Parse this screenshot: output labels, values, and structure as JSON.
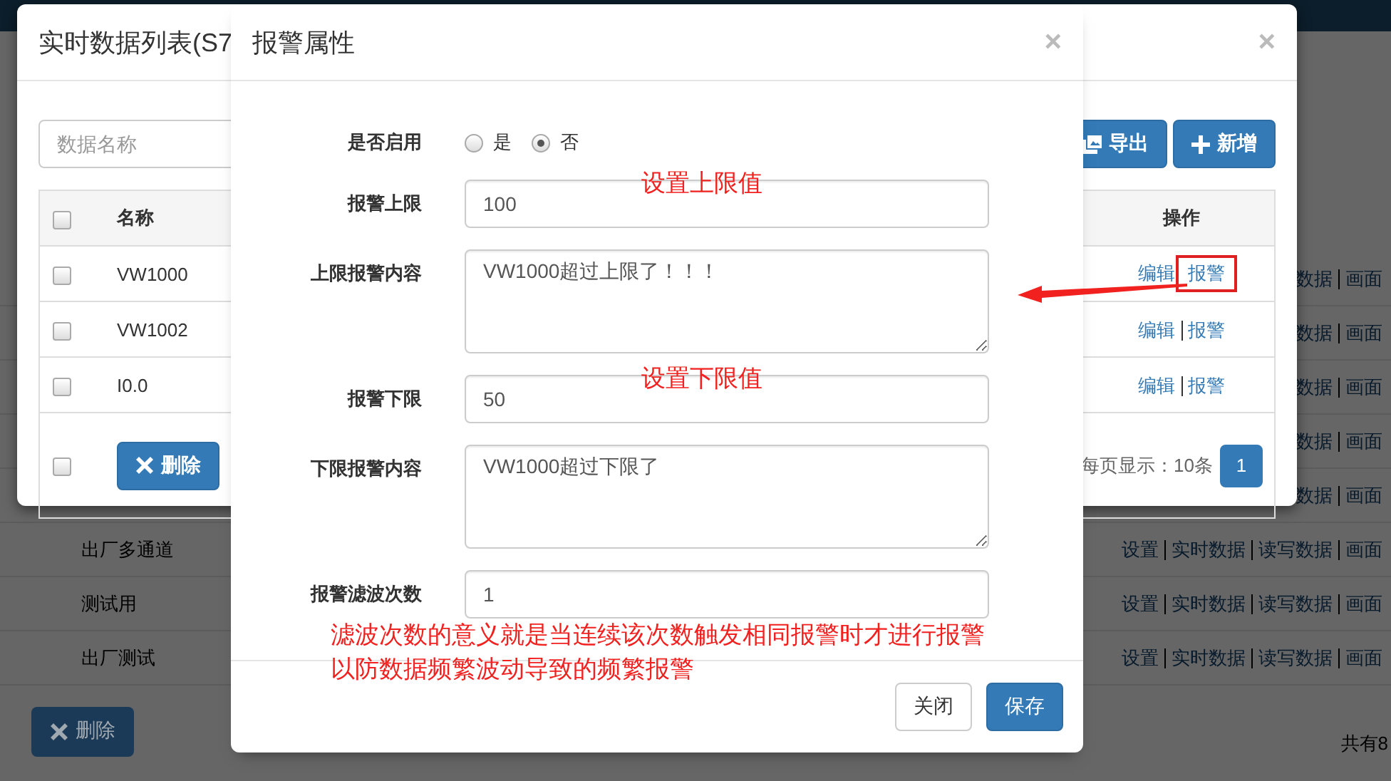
{
  "background_page": {
    "rows": [
      {
        "name": "",
        "actions": [
          {
            "label": "数据"
          },
          {
            "label": "画面"
          }
        ]
      },
      {
        "name": "",
        "actions": [
          {
            "label": "数据"
          },
          {
            "label": "画面"
          }
        ]
      },
      {
        "name": "",
        "actions": [
          {
            "label": "数据"
          },
          {
            "label": "画面"
          }
        ]
      },
      {
        "name": "",
        "actions": [
          {
            "label": "数据"
          },
          {
            "label": "画面"
          }
        ]
      },
      {
        "name": "",
        "actions": [
          {
            "label": "数据"
          },
          {
            "label": "画面"
          }
        ]
      },
      {
        "name": "出厂多通道",
        "actions": [
          {
            "label": "设置"
          },
          {
            "label": "实时数据"
          },
          {
            "label": "读写数据"
          },
          {
            "label": "画面"
          }
        ]
      },
      {
        "name": "测试用",
        "actions": [
          {
            "label": "设置"
          },
          {
            "label": "实时数据"
          },
          {
            "label": "读写数据"
          },
          {
            "label": "画面"
          }
        ]
      },
      {
        "name": "出厂测试",
        "actions": [
          {
            "label": "设置"
          },
          {
            "label": "实时数据"
          },
          {
            "label": "读写数据"
          },
          {
            "label": "画面"
          }
        ]
      }
    ],
    "delete_button": "删除",
    "total_text": "共有8"
  },
  "list_dialog": {
    "title": "实时数据列表(S7",
    "close": "×",
    "search": {
      "placeholder": "数据名称"
    },
    "toolbar_buttons": [
      {
        "label": "导出",
        "kind": "export"
      },
      {
        "label": "新增",
        "kind": "add"
      }
    ],
    "header": {
      "checked": false,
      "columns": [
        "名称",
        "操作"
      ]
    },
    "rows": [
      {
        "name": "VW1000",
        "checked": false,
        "actions": [
          {
            "label": "编辑",
            "highlighted": false
          },
          {
            "label": "报警",
            "highlighted": true
          }
        ]
      },
      {
        "name": "VW1002",
        "checked": false,
        "actions": [
          {
            "label": "编辑",
            "highlighted": false
          },
          {
            "label": "报警",
            "highlighted": false
          }
        ]
      },
      {
        "name": "I0.0",
        "checked": false,
        "actions": [
          {
            "label": "编辑",
            "highlighted": false
          },
          {
            "label": "报警",
            "highlighted": false
          }
        ]
      }
    ],
    "footer": {
      "checked": false,
      "delete_button": "删除",
      "page_size_text": "每页显示：10条",
      "pages": [
        {
          "label": "1",
          "selected": true
        }
      ]
    }
  },
  "alarm_dialog": {
    "title": "报警属性",
    "close": "×",
    "fields": [
      {
        "kind": "radio",
        "label": "是否启用",
        "options": [
          {
            "label": "是",
            "selected": false
          },
          {
            "label": "否",
            "selected": true
          }
        ]
      },
      {
        "kind": "input",
        "label": "报警上限",
        "value": "100",
        "note_lines": [
          "设置上限值"
        ]
      },
      {
        "kind": "textarea",
        "label": "上限报警内容",
        "value": "VW1000超过上限了！！！"
      },
      {
        "kind": "input",
        "label": "报警下限",
        "value": "50",
        "note_lines": [
          "设置下限值"
        ]
      },
      {
        "kind": "textarea",
        "label": "下限报警内容",
        "value": "VW1000超过下限了"
      },
      {
        "kind": "input",
        "label": "报警滤波次数",
        "value": "1",
        "note_lines": [
          "滤波次数的意义就是当连续该次数触发相同报警时才进行报警",
          "以防数据频繁波动导致的频繁报警"
        ]
      }
    ],
    "buttons": [
      {
        "label": "关闭",
        "kind": "default"
      },
      {
        "label": "保存",
        "kind": "primary"
      }
    ]
  }
}
